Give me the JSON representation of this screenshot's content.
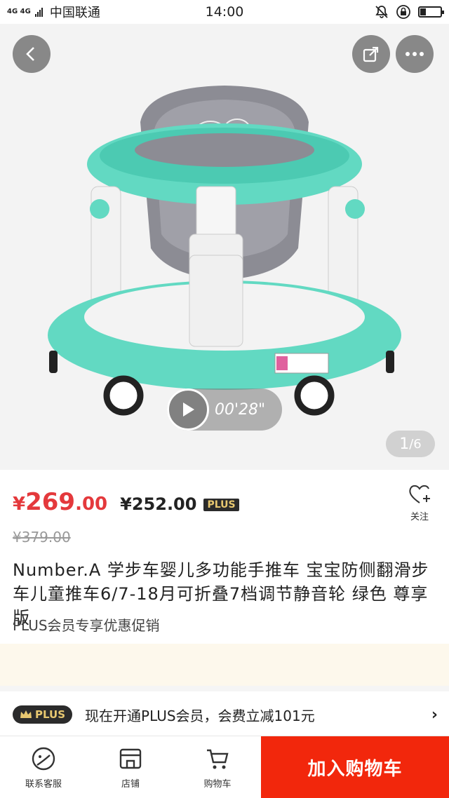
{
  "status_bar": {
    "network": "4G 4G",
    "carrier": "中国联通",
    "time": "14:00",
    "icons": [
      "bell-muted-icon",
      "lock-rotation-icon",
      "battery-icon"
    ],
    "battery_level": 0.25
  },
  "gallery": {
    "image_desc_icon": "baby-walker-product-image",
    "counter_current": "1",
    "counter_sep": "/6",
    "video_duration": "00'28\"",
    "back_icon": "back-arrow-icon",
    "share_icon": "share-icon",
    "more_icon": "more-dots-icon"
  },
  "price": {
    "symbol": "¥",
    "main_int": "269",
    "main_dec": ".00",
    "plus_price": "¥252.00",
    "plus_tag": "PLUS",
    "original": "¥379.00"
  },
  "follow": {
    "label": "关注",
    "icon": "heart-plus-icon"
  },
  "product": {
    "title": "Number.A 学步车婴儿多功能手推车 宝宝防侧翻滑步车儿童推车6/7-18月可折叠7档调节静音轮 绿色 尊享版",
    "promo": "PLUS会员专享优惠促销"
  },
  "plus_offer": {
    "badge": "PLUS",
    "text": "现在开通PLUS会员，会费立减101元",
    "chevron": "›"
  },
  "bottom_bar": {
    "tabs": [
      {
        "label": "联系客服",
        "icon": "customer-service-icon"
      },
      {
        "label": "店铺",
        "icon": "shop-icon"
      },
      {
        "label": "购物车",
        "icon": "cart-icon"
      }
    ],
    "cart_button": "加入购物车"
  },
  "colors": {
    "accent_red": "#e4393c",
    "cart_button": "#f2270c",
    "plus_gold": "#e8c870",
    "plus_dark": "#2b2b2b",
    "walker_teal": "#5fd8c0"
  }
}
